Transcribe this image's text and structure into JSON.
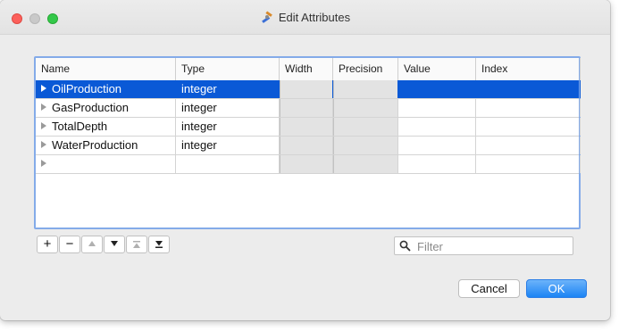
{
  "window": {
    "title": "Edit Attributes",
    "title_icon": "tools-icon"
  },
  "table": {
    "columns": [
      "Name",
      "Type",
      "Width",
      "Precision",
      "Value",
      "Index"
    ],
    "rows": [
      {
        "name": "OilProduction",
        "type": "integer",
        "width": "",
        "precision": "",
        "value": "",
        "index": "",
        "selected": true
      },
      {
        "name": "GasProduction",
        "type": "integer",
        "width": "",
        "precision": "",
        "value": "",
        "index": "",
        "selected": false
      },
      {
        "name": "TotalDepth",
        "type": "integer",
        "width": "",
        "precision": "",
        "value": "",
        "index": "",
        "selected": false
      },
      {
        "name": "WaterProduction",
        "type": "integer",
        "width": "",
        "precision": "",
        "value": "",
        "index": "",
        "selected": false
      },
      {
        "name": "",
        "type": "",
        "width": "",
        "precision": "",
        "value": "",
        "index": "",
        "selected": false
      }
    ]
  },
  "toolbar": {
    "add_label": "+",
    "remove_label": "−"
  },
  "filter": {
    "placeholder": "Filter",
    "value": ""
  },
  "actions": {
    "cancel_label": "Cancel",
    "ok_label": "OK"
  },
  "colors": {
    "selection": "#0a59d6",
    "accent": "#1c84f4"
  }
}
